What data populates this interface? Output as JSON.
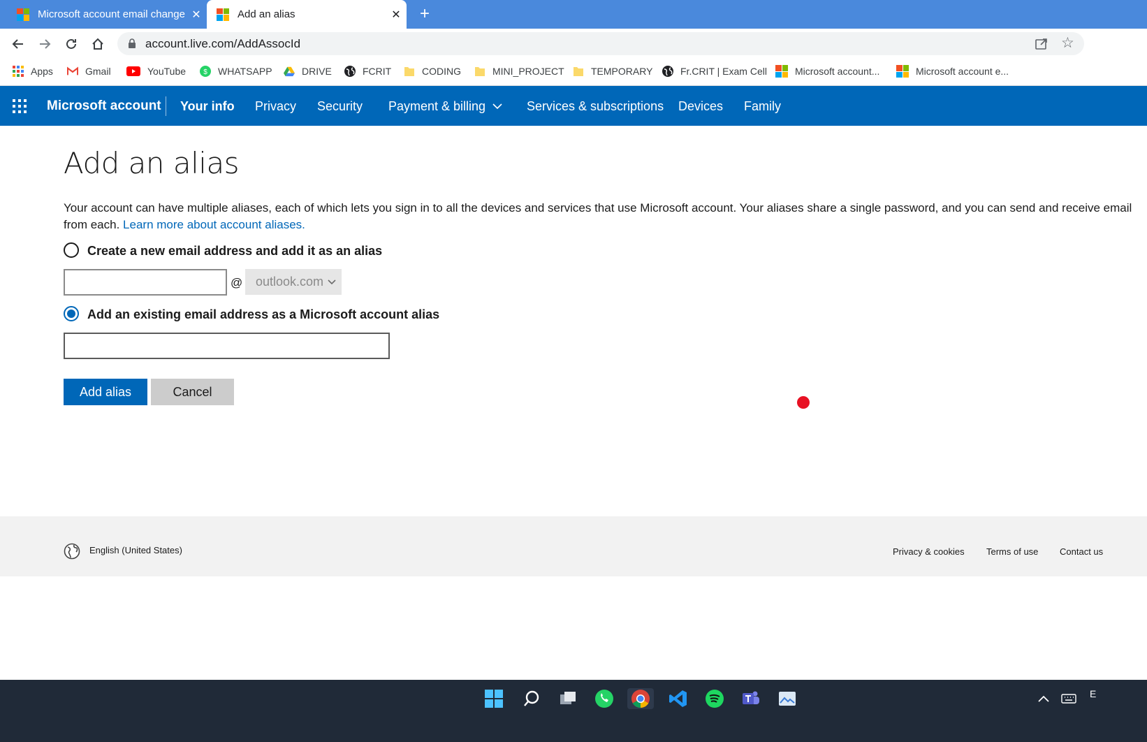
{
  "browser": {
    "tabs": [
      {
        "title": "Microsoft account email change - ",
        "close": "✕"
      },
      {
        "title": "Add an alias",
        "close": "✕"
      }
    ],
    "new_tab": "+",
    "url": "account.live.com/AddAssocId",
    "bookmarks": [
      {
        "label": "Apps",
        "icon": "apps-grid-icon"
      },
      {
        "label": "Gmail",
        "icon": "gmail-icon"
      },
      {
        "label": "YouTube",
        "icon": "youtube-icon"
      },
      {
        "label": "WHATSAPP",
        "icon": "whatsapp-icon"
      },
      {
        "label": "DRIVE",
        "icon": "drive-icon"
      },
      {
        "label": "FCRIT",
        "icon": "globe-icon"
      },
      {
        "label": "CODING",
        "icon": "folder-icon"
      },
      {
        "label": "MINI_PROJECT",
        "icon": "folder-icon"
      },
      {
        "label": "TEMPORARY",
        "icon": "folder-icon"
      },
      {
        "label": "Fr.CRIT | Exam Cell",
        "icon": "globe-icon"
      },
      {
        "label": "Microsoft account...",
        "icon": "microsoft-logo-icon"
      },
      {
        "label": "Microsoft account e...",
        "icon": "microsoft-logo-icon"
      }
    ]
  },
  "header": {
    "brand": "Microsoft account",
    "nav": [
      "Your info",
      "Privacy",
      "Security",
      "Payment & billing",
      "Services & subscriptions",
      "Devices",
      "Family"
    ]
  },
  "main": {
    "title": "Add an alias",
    "description": "Your account can have multiple aliases, each of which lets you sign in to all the devices and services that use Microsoft account. Your aliases share a single password, and you can send and receive email from each.",
    "learn_more": "Learn more about account aliases.",
    "option_new": {
      "label": "Create a new email address and add it as an alias",
      "checked": false,
      "value": "",
      "at": "@",
      "domain": "outlook.com"
    },
    "option_existing": {
      "label": "Add an existing email address as a Microsoft account alias",
      "checked": true,
      "value": ""
    },
    "add_button": "Add alias",
    "cancel_button": "Cancel"
  },
  "footer": {
    "locale": "English (United States)",
    "links": [
      "Privacy & cookies",
      "Terms of use",
      "Contact us"
    ]
  },
  "taskbar": {
    "icons": [
      "windows-start-icon",
      "search-icon",
      "task-view-icon",
      "whatsapp-icon",
      "chrome-icon",
      "vscode-icon",
      "spotify-icon",
      "teams-icon",
      "photos-icon"
    ],
    "tray_edge": "E"
  },
  "colors": {
    "tab_strip": "#4a89dc",
    "ms_blue": "#0067b8",
    "footer_bg": "#f2f2f2",
    "taskbar_bg": "#202a38",
    "cursor_dot": "#e81123"
  }
}
